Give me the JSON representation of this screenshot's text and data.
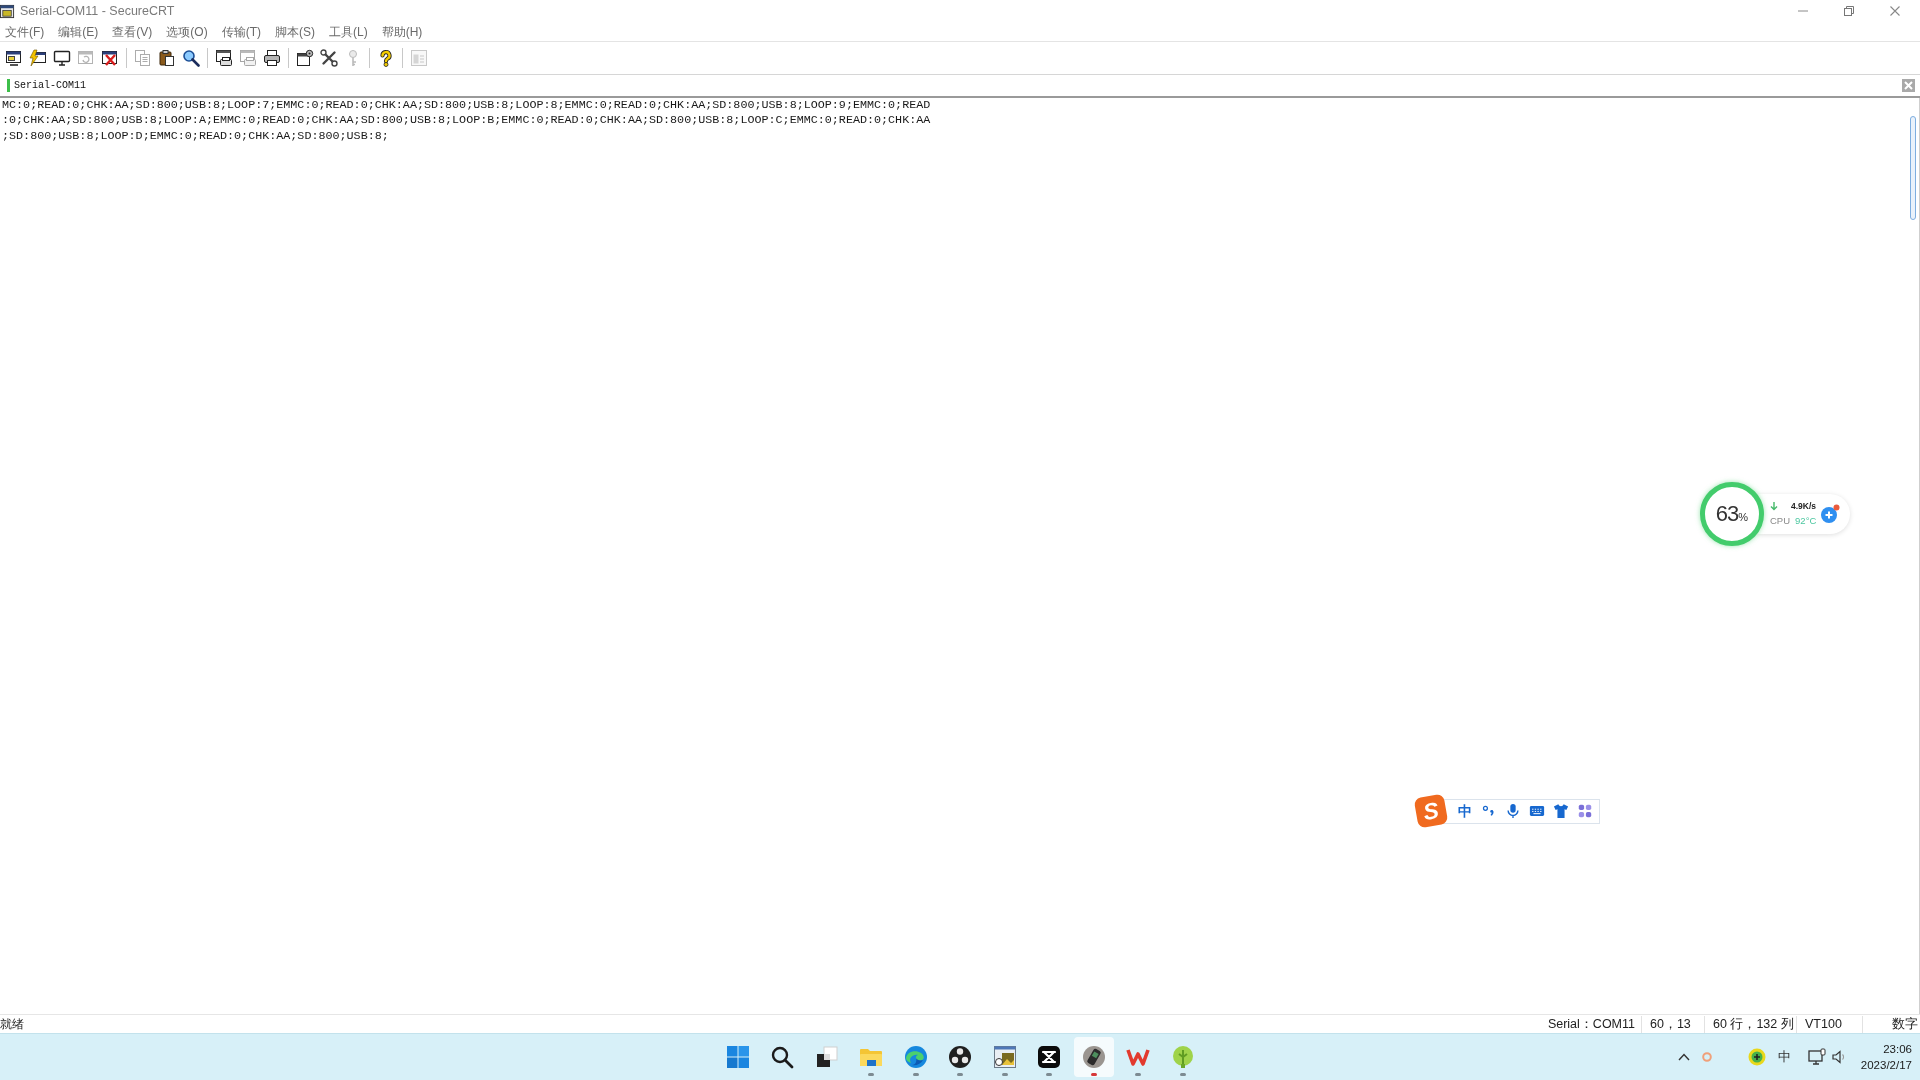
{
  "window": {
    "title": "Serial-COM11 - SecureCRT"
  },
  "menu": [
    "文件(F)",
    "编辑(E)",
    "查看(V)",
    "选项(O)",
    "传输(T)",
    "脚本(S)",
    "工具(L)",
    "帮助(H)"
  ],
  "toolbar": [
    [
      {
        "kind": "connect",
        "disabled": false
      },
      {
        "kind": "quick-connect",
        "disabled": false
      },
      {
        "kind": "connect-tab",
        "disabled": false
      },
      {
        "kind": "reconnect",
        "disabled": true
      },
      {
        "kind": "disconnect",
        "disabled": false
      }
    ],
    [
      {
        "kind": "copy",
        "disabled": true
      },
      {
        "kind": "paste",
        "disabled": false
      },
      {
        "kind": "find",
        "disabled": false
      }
    ],
    [
      {
        "kind": "print-screen",
        "disabled": false
      },
      {
        "kind": "print-selection",
        "disabled": true
      },
      {
        "kind": "print",
        "disabled": false
      }
    ],
    [
      {
        "kind": "session-options",
        "disabled": false
      },
      {
        "kind": "global-options",
        "disabled": false
      },
      {
        "kind": "keymap",
        "disabled": true
      }
    ],
    [
      {
        "kind": "help",
        "disabled": false
      }
    ],
    [
      {
        "kind": "sftp",
        "disabled": true
      }
    ]
  ],
  "tabs": [
    {
      "label": "Serial-COM11",
      "connected": true
    }
  ],
  "terminal": {
    "lines": [
      "MC:0;READ:0;CHK:AA;SD:800;USB:8;LOOP:7;EMMC:0;READ:0;CHK:AA;SD:800;USB:8;LOOP:8;EMMC:0;READ:0;CHK:AA;SD:800;USB:8;LOOP:9;EMMC:0;READ",
      ":0;CHK:AA;SD:800;USB:8;LOOP:A;EMMC:0;READ:0;CHK:AA;SD:800;USB:8;LOOP:B;EMMC:0;READ:0;CHK:AA;SD:800;USB:8;LOOP:C;EMMC:0;READ:0;CHK:AA",
      ";SD:800;USB:8;LOOP:D;EMMC:0;READ:0;CHK:AA;SD:800;USB:8;"
    ]
  },
  "status_bar": {
    "message": "就绪",
    "panes": [
      "Serial：COM11",
      "60，13",
      "60 行，132 列",
      "VT100",
      "数字"
    ]
  },
  "cpu_widget": {
    "usage": "63",
    "usage_unit": "%",
    "download_speed": "4.9K/s",
    "cpu_label": "CPU",
    "cpu_temperature": "92°C"
  },
  "ime_toolbar": {
    "logo": "S",
    "mode": "中"
  },
  "taskbar": {
    "apps": [
      {
        "kind": "start",
        "running": false,
        "selected": false
      },
      {
        "kind": "search",
        "running": false,
        "selected": false
      },
      {
        "kind": "task-view",
        "running": false,
        "selected": false
      },
      {
        "kind": "explorer",
        "running": true,
        "selected": false
      },
      {
        "kind": "edge",
        "running": true,
        "selected": false
      },
      {
        "kind": "obs",
        "running": true,
        "selected": false
      },
      {
        "kind": "image-viewer",
        "running": true,
        "selected": false
      },
      {
        "kind": "capcut",
        "running": true,
        "selected": false
      },
      {
        "kind": "device",
        "running": true,
        "selected": true
      },
      {
        "kind": "wps",
        "running": true,
        "selected": false
      },
      {
        "kind": "robot",
        "running": true,
        "selected": false
      }
    ],
    "tray": {
      "input_mode": "中"
    },
    "clock": {
      "time": "23:06",
      "date": "2023/2/17"
    }
  }
}
